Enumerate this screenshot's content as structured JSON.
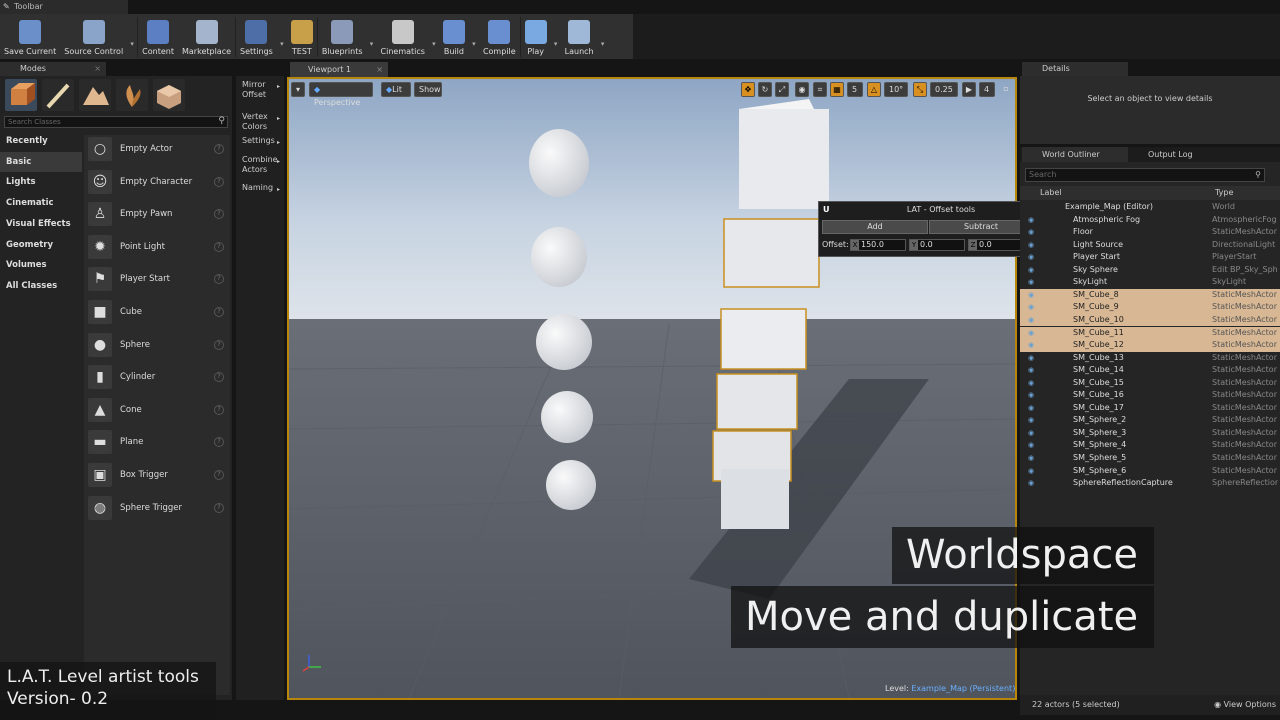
{
  "toolbar_tab": "Toolbar",
  "toolbar": [
    {
      "label": "Save Current",
      "icon": "save-icon",
      "color": "#6a8fc9",
      "arrow": false
    },
    {
      "label": "Source Control",
      "icon": "source-control-icon",
      "color": "#8aa3c8",
      "arrow": true
    },
    {
      "label": "Content",
      "icon": "content-icon",
      "color": "#5b7fc2",
      "arrow": false
    },
    {
      "label": "Marketplace",
      "icon": "marketplace-icon",
      "color": "#a4b4cc",
      "arrow": false
    },
    {
      "label": "Settings",
      "icon": "settings-icon",
      "color": "#4e6ea8",
      "arrow": true
    },
    {
      "label": "TEST",
      "icon": "test-icon",
      "color": "#c8a04a",
      "arrow": false
    },
    {
      "label": "Blueprints",
      "icon": "blueprints-icon",
      "color": "#8a9ab8",
      "arrow": true
    },
    {
      "label": "Cinematics",
      "icon": "cinematics-icon",
      "color": "#c8c8c8",
      "arrow": true
    },
    {
      "label": "Build",
      "icon": "build-icon",
      "color": "#6a8fd0",
      "arrow": true
    },
    {
      "label": "Compile",
      "icon": "compile-icon",
      "color": "#6a8fd0",
      "arrow": false
    },
    {
      "label": "Play",
      "icon": "play-icon",
      "color": "#7aa8e0",
      "arrow": true
    },
    {
      "label": "Launch",
      "icon": "launch-icon",
      "color": "#a0b8d8",
      "arrow": true
    }
  ],
  "modes": {
    "tab": "Modes",
    "search_placeholder": "Search Classes",
    "categories": [
      "Recently Placed",
      "Basic",
      "Lights",
      "Cinematic",
      "Visual Effects",
      "Geometry",
      "Volumes",
      "All Classes"
    ],
    "active_category": "Basic",
    "items": [
      "Empty Actor",
      "Empty Character",
      "Empty Pawn",
      "Point Light",
      "Player Start",
      "Cube",
      "Sphere",
      "Cylinder",
      "Cone",
      "Plane",
      "Box Trigger",
      "Sphere Trigger"
    ]
  },
  "submenu": [
    {
      "label": "Mirror",
      "label2": "Offset"
    },
    {
      "label": "Vertex",
      "label2": "Colors"
    },
    {
      "label": "Settings",
      "label2": ""
    },
    {
      "label": "Combine",
      "label2": "Actors"
    },
    {
      "label": "Naming",
      "label2": ""
    }
  ],
  "viewport": {
    "tab": "Viewport 1",
    "perspective": "Perspective",
    "lit": "Lit",
    "show": "Show",
    "grid_snap": "5",
    "rot_snap": "10°",
    "scale_snap": "0.25",
    "cam_speed": "4",
    "level_label": "Level:",
    "level_name": "Example_Map (Persistent)"
  },
  "lat": {
    "title": "LAT - Offset tools",
    "add": "Add",
    "subtract": "Subtract",
    "offset_label": "Offset:",
    "x_label": "X",
    "x": "150.0",
    "y_label": "Y",
    "y": "0.0",
    "z_label": "Z",
    "z": "0.0"
  },
  "details": {
    "tab": "Details",
    "empty": "Select an object to view details"
  },
  "outliner": {
    "tab": "World Outliner",
    "log_tab": "Output Log",
    "search_placeholder": "Search",
    "col_label": "Label",
    "col_type": "Type",
    "rows": [
      {
        "name": "Example_Map (Editor)",
        "type": "World",
        "sel": false
      },
      {
        "name": "Atmospheric Fog",
        "type": "AtmosphericFog",
        "sel": false
      },
      {
        "name": "Floor",
        "type": "StaticMeshActor",
        "sel": false
      },
      {
        "name": "Light Source",
        "type": "DirectionalLight",
        "sel": false
      },
      {
        "name": "Player Start",
        "type": "PlayerStart",
        "sel": false
      },
      {
        "name": "Sky Sphere",
        "type": "Edit BP_Sky_Sph",
        "sel": false
      },
      {
        "name": "SkyLight",
        "type": "SkyLight",
        "sel": false
      },
      {
        "name": "SM_Cube_8",
        "type": "StaticMeshActor",
        "sel": true
      },
      {
        "name": "SM_Cube_9",
        "type": "StaticMeshActor",
        "sel": true
      },
      {
        "name": "SM_Cube_10",
        "type": "StaticMeshActor",
        "sel": true
      },
      {
        "name": "SM_Cube_11",
        "type": "StaticMeshActor",
        "sel": true
      },
      {
        "name": "SM_Cube_12",
        "type": "StaticMeshActor",
        "sel": true
      },
      {
        "name": "SM_Cube_13",
        "type": "StaticMeshActor",
        "sel": false
      },
      {
        "name": "SM_Cube_14",
        "type": "StaticMeshActor",
        "sel": false
      },
      {
        "name": "SM_Cube_15",
        "type": "StaticMeshActor",
        "sel": false
      },
      {
        "name": "SM_Cube_16",
        "type": "StaticMeshActor",
        "sel": false
      },
      {
        "name": "SM_Cube_17",
        "type": "StaticMeshActor",
        "sel": false
      },
      {
        "name": "SM_Sphere_2",
        "type": "StaticMeshActor",
        "sel": false
      },
      {
        "name": "SM_Sphere_3",
        "type": "StaticMeshActor",
        "sel": false
      },
      {
        "name": "SM_Sphere_4",
        "type": "StaticMeshActor",
        "sel": false
      },
      {
        "name": "SM_Sphere_5",
        "type": "StaticMeshActor",
        "sel": false
      },
      {
        "name": "SM_Sphere_6",
        "type": "StaticMeshActor",
        "sel": false
      },
      {
        "name": "SphereReflectionCapture",
        "type": "SphereReflection",
        "sel": false
      }
    ],
    "footer_count": "22 actors (5 selected)",
    "view_options": "View Options"
  },
  "captions": {
    "line1": "Worldspace",
    "line2": "Move and duplicate",
    "credit1": "L.A.T. Level artist tools",
    "credit2": "Version- 0.2"
  },
  "colors": {
    "selection": "#d8b894",
    "accent": "#b8860b",
    "sky": "#9fb3cc"
  }
}
